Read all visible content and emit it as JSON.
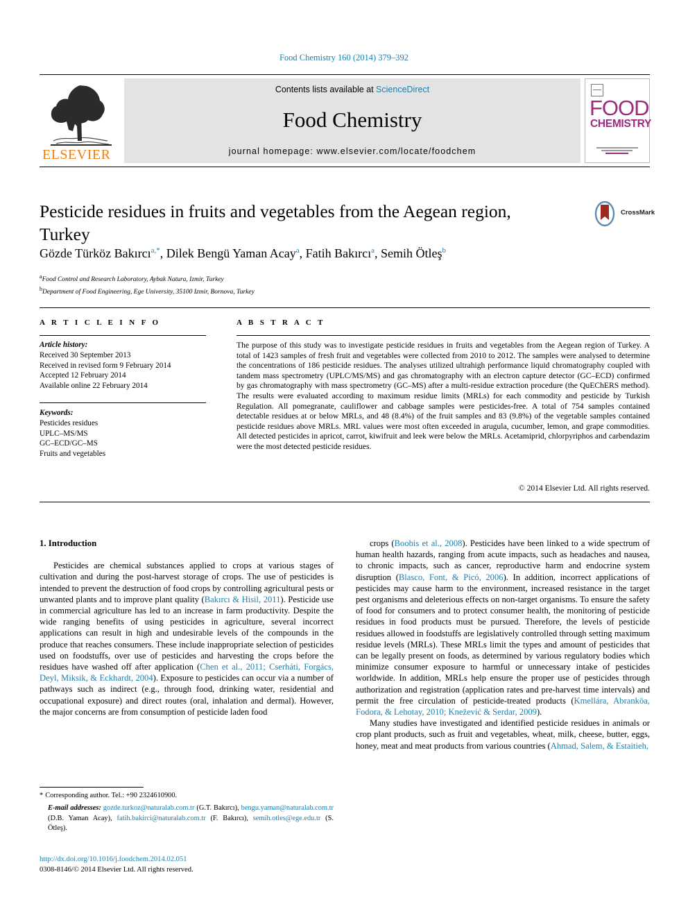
{
  "running_head": "Food Chemistry 160 (2014) 379–392",
  "masthead": {
    "contents_prefix": "Contents lists available at ",
    "sciencedirect": "ScienceDirect",
    "journal_title": "Food Chemistry",
    "homepage": "journal homepage: www.elsevier.com/locate/foodchem",
    "publisher": "ELSEVIER",
    "cover_title_line1": "FOOD",
    "cover_title_line2": "CHEMISTRY",
    "accent_color": "#1b7fad",
    "cover_color": "#9c2a7e",
    "elsevier_color": "#F07F13"
  },
  "article": {
    "title": "Pesticide residues in fruits and vegetables from the Aegean region, Turkey",
    "crossmark_label": "CrossMark",
    "authors": [
      {
        "name": "Gözde Türköz Bakırcı",
        "marks": "a,*"
      },
      {
        "name": "Dilek Bengü Yaman Acay",
        "marks": "a"
      },
      {
        "name": "Fatih Bakırcı",
        "marks": "a"
      },
      {
        "name": "Semih Ötleş",
        "marks": "b"
      }
    ],
    "affiliations": [
      {
        "mark": "a",
        "text": "Food Control and Research Laboratory, Aybak Natura, Izmir, Turkey"
      },
      {
        "mark": "b",
        "text": "Department of Food Engineering, Ege University, 35100 Izmir, Bornova, Turkey"
      }
    ]
  },
  "headers": {
    "article_info": "A R T I C L E  I N F O",
    "abstract": "A B S T R A C T"
  },
  "article_history": {
    "label": "Article history:",
    "lines": [
      "Received 30 September 2013",
      "Received in revised form 9 February 2014",
      "Accepted 12 February 2014",
      "Available online 22 February 2014"
    ]
  },
  "keywords": {
    "label": "Keywords:",
    "items": [
      "Pesticides residues",
      "UPLC–MS/MS",
      "GC–ECD/GC–MS",
      "Fruits and vegetables"
    ]
  },
  "abstract_text": "The purpose of this study was to investigate pesticide residues in fruits and vegetables from the Aegean region of Turkey. A total of 1423 samples of fresh fruit and vegetables were collected from 2010 to 2012. The samples were analysed to determine the concentrations of 186 pesticide residues. The analyses utilized ultrahigh performance liquid chromatography coupled with tandem mass spectrometry (UPLC/MS/MS) and gas chromatography with an electron capture detector (GC–ECD) confirmed by gas chromatography with mass spectrometry (GC–MS) after a multi-residue extraction procedure (the QuEChERS method). The results were evaluated according to maximum residue limits (MRLs) for each commodity and pesticide by Turkish Regulation. All pomegranate, cauliflower and cabbage samples were pesticides-free. A total of 754 samples contained detectable residues at or below MRLs, and 48 (8.4%) of the fruit samples and 83 (9.8%) of the vegetable samples contained pesticide residues above MRLs. MRL values were most often exceeded in arugula, cucumber, lemon, and grape commodities. All detected pesticides in apricot, carrot, kiwifruit and leek were below the MRLs. Acetamiprid, chlorpyriphos and carbendazim were the most detected pesticide residues.",
  "copyright": "© 2014 Elsevier Ltd. All rights reserved.",
  "body": {
    "section_title": "1. Introduction",
    "left_para_1_a": "Pesticides are chemical substances applied to crops at various stages of cultivation and during the post-harvest storage of crops. The use of pesticides is intended to prevent the destruction of food crops by controlling agricultural pests or unwanted plants and to improve plant quality (",
    "left_ref_1": "Bakırcı & Hisil, 2011",
    "left_para_1_b": "). Pesticide use in commercial agriculture has led to an increase in farm productivity. Despite the wide ranging benefits of using pesticides in agriculture, several incorrect applications can result in high and undesirable levels of the compounds in the produce that reaches consumers. These include inappropriate selection of pesticides used on foodstuffs, over use of pesticides and harvesting the crops before the residues have washed off after application (",
    "left_ref_2": "Chen et al., 2011; Cserháti, Forgács, Deyl, Miksik, & Eckhardt, 2004",
    "left_para_1_c": "). Exposure to pesticides can occur via a number of pathways such as indirect (e.g., through food, drinking water, residential and occupational exposure) and direct routes (oral, inhalation and dermal). However, the major concerns are from consumption of pesticide laden food",
    "right_para_1_a": "crops (",
    "right_ref_1": "Boobis et al., 2008",
    "right_para_1_b": "). Pesticides have been linked to a wide spectrum of human health hazards, ranging from acute impacts, such as headaches and nausea, to chronic impacts, such as cancer, reproductive harm and endocrine system disruption (",
    "right_ref_2": "Blasco, Font, & Picó, 2006",
    "right_para_1_c": "). In addition, incorrect applications of pesticides may cause harm to the environment, increased resistance in the target pest organisms and deleterious effects on non-target organisms. To ensure the safety of food for consumers and to protect consumer health, the monitoring of pesticide residues in food products must be pursued. Therefore, the levels of pesticide residues allowed in foodstuffs are legislatively controlled through setting maximum residue levels (MRLs). These MRLs limit the types and amount of pesticides that can be legally present on foods, as determined by various regulatory bodies which minimize consumer exposure to harmful or unnecessary intake of pesticides worldwide. In addition, MRLs help ensure the proper use of pesticides through authorization and registration (application rates and pre-harvest time intervals) and permit the free circulation of pesticide-treated products (",
    "right_ref_3": "Kmellára, Abranköa, Fodora, & Lehotay, 2010; Knežević & Serdar, 2009",
    "right_para_1_d": ").",
    "right_para_2_a": "Many studies have investigated and identified pesticide residues in animals or crop plant products, such as fruit and vegetables, wheat, milk, cheese, butter, eggs, honey, meat and meat products from various countries (",
    "right_ref_4": "Ahmad, Salem, & Estaitieh,"
  },
  "footnotes": {
    "corresponding": "Corresponding author. Tel.: +90 2324610900.",
    "email_label": "E-mail addresses:",
    "emails": [
      {
        "address": "gozde.turkoz@naturalab.com.tr",
        "person": "(G.T. Bakırcı)"
      },
      {
        "address": "bengu.yaman@naturalab.com.tr",
        "person": "(D.B. Yaman Acay)"
      },
      {
        "address": "fatih.bakirci@naturalab.com.tr",
        "person": "(F. Bakırcı)"
      },
      {
        "address": "semih.otles@ege.edu.tr",
        "person": "(S. Ötleş)"
      }
    ],
    "doi": "http://dx.doi.org/10.1016/j.foodchem.2014.02.051",
    "issn_line": "0308-8146/© 2014 Elsevier Ltd. All rights reserved."
  }
}
